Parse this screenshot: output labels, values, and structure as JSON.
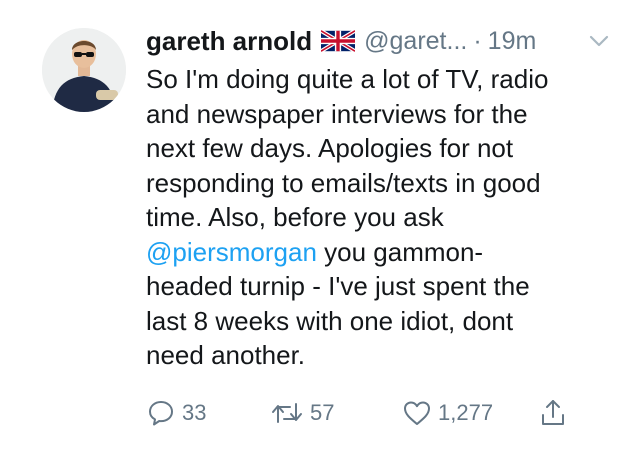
{
  "tweet": {
    "display_name": "gareth arnold",
    "handle": "@garet...",
    "separator": "·",
    "time": "19m",
    "flag_icon": "union-jack-flag",
    "body_lines": [
      "So I'm doing quite a lot of TV, radio",
      "and newspaper interviews for the",
      "next few days. Apologies for not",
      "responding to emails/texts in good",
      "time. Also, before you ask"
    ],
    "mention": "@piersmorgan",
    "mention_suffix": " you gammon-",
    "body_lines_after": [
      "headed turnip - I've just spent the",
      "last 8 weeks with one idiot, dont",
      "need another."
    ]
  },
  "actions": {
    "reply_count": "33",
    "retweet_count": "57",
    "like_count": "1,277"
  },
  "colors": {
    "mention": "#1da1f2",
    "muted": "#657786",
    "text": "#14171a"
  }
}
